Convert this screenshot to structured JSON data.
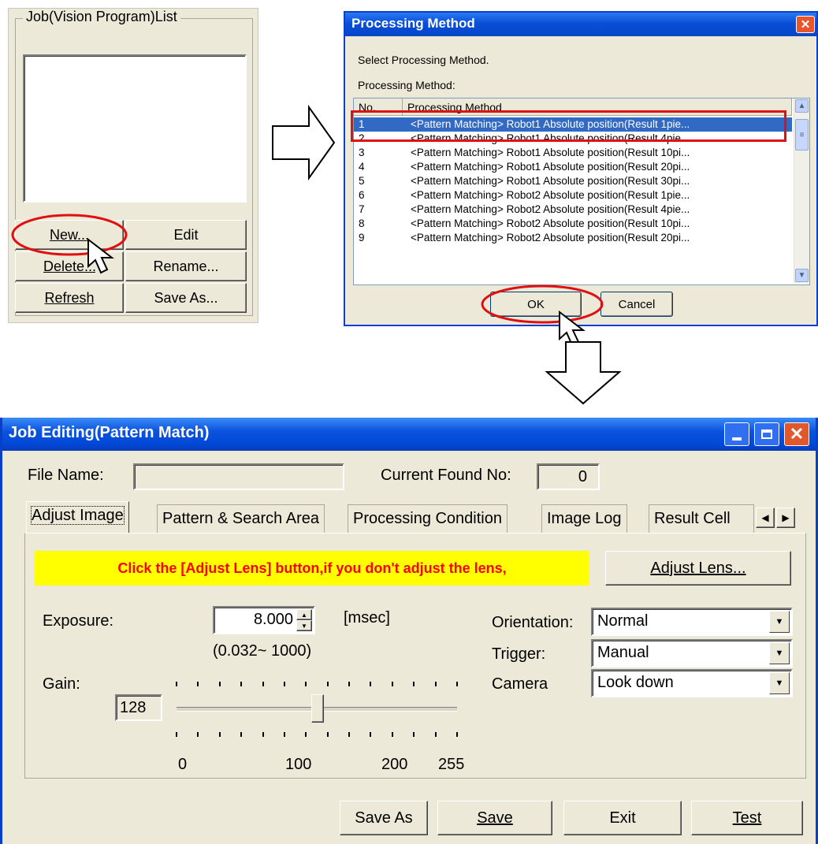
{
  "job_list": {
    "group_title": "Job(Vision Program)List",
    "buttons": {
      "new": "New...",
      "edit": "Edit",
      "delete": "Delete...",
      "rename": "Rename...",
      "refresh": "Refresh",
      "save_as": "Save As..."
    }
  },
  "processing_dialog": {
    "title": "Processing Method",
    "instruction": "Select Processing Method.",
    "list_label": "Processing Method:",
    "columns": [
      "No.",
      "Processing Method"
    ],
    "rows": [
      {
        "no": "1",
        "method": "<Pattern Matching> Robot1 Absolute position(Result 1pie..."
      },
      {
        "no": "2",
        "method": "<Pattern Matching> Robot1 Absolute position(Result 4pie..."
      },
      {
        "no": "3",
        "method": "<Pattern Matching> Robot1 Absolute position(Result 10pi..."
      },
      {
        "no": "4",
        "method": "<Pattern Matching> Robot1 Absolute position(Result 20pi..."
      },
      {
        "no": "5",
        "method": "<Pattern Matching> Robot1 Absolute position(Result 30pi..."
      },
      {
        "no": "6",
        "method": "<Pattern Matching> Robot2 Absolute position(Result 1pie..."
      },
      {
        "no": "7",
        "method": "<Pattern Matching> Robot2 Absolute position(Result 4pie..."
      },
      {
        "no": "8",
        "method": "<Pattern Matching> Robot2 Absolute position(Result 10pi..."
      },
      {
        "no": "9",
        "method": "<Pattern Matching> Robot2 Absolute position(Result 20pi..."
      }
    ],
    "ok_label": "OK",
    "cancel_label": "Cancel"
  },
  "job_editing": {
    "title": "Job Editing(Pattern Match)",
    "file_name_label": "File Name:",
    "file_name_value": "",
    "current_found_label": "Current Found No:",
    "current_found_value": "0",
    "tabs": [
      "Adjust Image",
      "Pattern & Search Area",
      "Processing Condition",
      "Image Log",
      "Result Cell"
    ],
    "warning": "Click the [Adjust Lens] button,if you don't adjust the lens,",
    "adjust_lens_label": "Adjust Lens...",
    "exposure_label": "Exposure:",
    "exposure_value": "8.000",
    "exposure_unit": "[msec]",
    "exposure_range": "(0.032~ 1000)",
    "gain_label": "Gain:",
    "gain_value": "128",
    "gain_slider_fraction": 0.502,
    "gain_scale_labels": [
      "0",
      "100",
      "200",
      "255"
    ],
    "orientation_label": "Orientation:",
    "orientation_value": "Normal",
    "trigger_label": "Trigger:",
    "trigger_value": "Manual",
    "camera_label": "Camera",
    "camera_value": "Look down",
    "bottom_buttons": [
      "Save As",
      "Save",
      "Exit",
      "Test"
    ]
  },
  "colors": {
    "highlight_red": "#e01010",
    "warning_bg": "#ffff00",
    "warning_text": "#ff0000",
    "titlebar_blue": "#0a4ed8"
  }
}
